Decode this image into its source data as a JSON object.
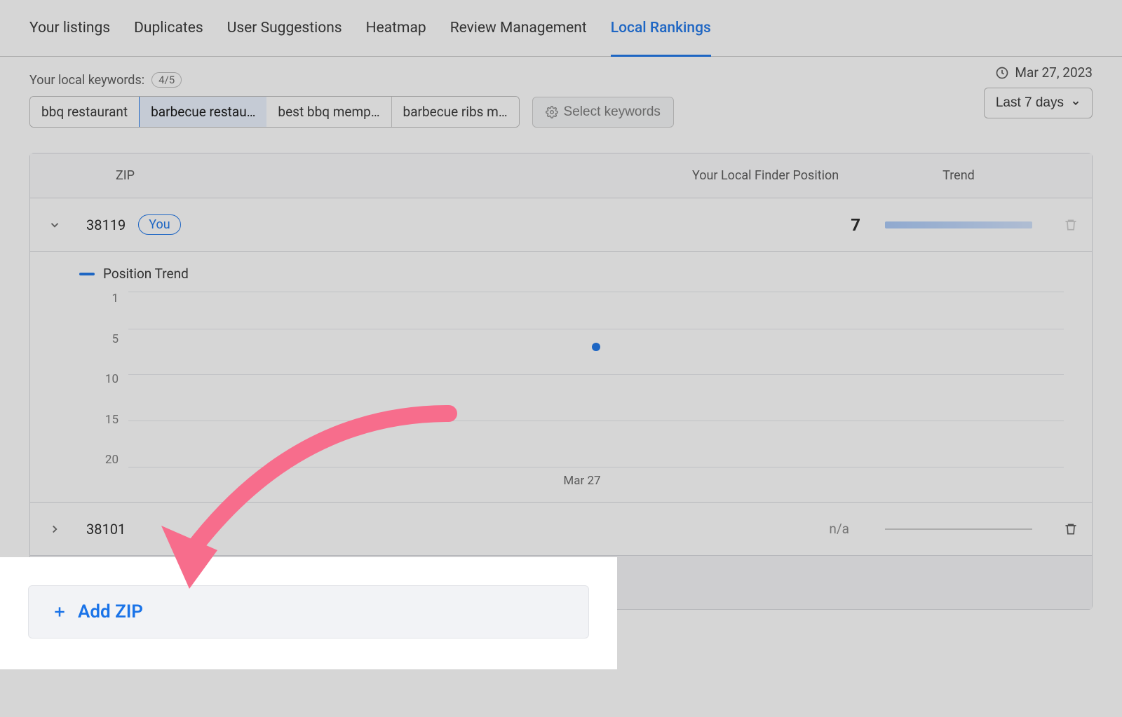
{
  "tabs": {
    "items": [
      {
        "label": "Your listings"
      },
      {
        "label": "Duplicates"
      },
      {
        "label": "User Suggestions"
      },
      {
        "label": "Heatmap"
      },
      {
        "label": "Review Management"
      },
      {
        "label": "Local Rankings"
      }
    ],
    "active_index": 5
  },
  "keywords": {
    "label": "Your local keywords:",
    "count": "4/5",
    "chips": [
      {
        "label": "bbq restaurant"
      },
      {
        "label": "barbecue restau…"
      },
      {
        "label": "best bbq memp…"
      },
      {
        "label": "barbecue ribs m…"
      }
    ],
    "selected_index": 1,
    "select_button": "Select keywords"
  },
  "date": {
    "current": "Mar 27, 2023",
    "range": "Last 7 days"
  },
  "table": {
    "headers": {
      "zip": "ZIP",
      "position": "Your Local Finder Position",
      "trend": "Trend"
    },
    "rows": [
      {
        "zip": "38119",
        "you": "You",
        "position": "7",
        "na": null
      },
      {
        "zip": "38101",
        "you": null,
        "position": null,
        "na": "n/a"
      }
    ]
  },
  "chart_data": {
    "type": "scatter",
    "legend": "Position Trend",
    "y_ticks": [
      1,
      5,
      10,
      15,
      20
    ],
    "ylim": [
      1,
      20
    ],
    "x_labels": [
      "Mar 27"
    ],
    "series": [
      {
        "name": "Position Trend",
        "points": [
          {
            "x": "Mar 27",
            "y": 7
          }
        ]
      }
    ]
  },
  "add_zip": {
    "label": "Add ZIP"
  }
}
